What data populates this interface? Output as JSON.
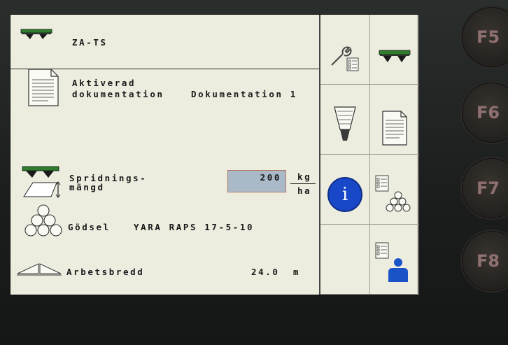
{
  "header": {
    "title": "ZA-TS"
  },
  "documentation": {
    "label_line1": "Aktiverad",
    "label_line2": "dokumentation",
    "value": "Dokumentation 1"
  },
  "application_rate": {
    "label_line1": "Spridnings-",
    "label_line2": "mängd",
    "value": "200",
    "unit_numerator": "kg",
    "unit_denominator": "ha"
  },
  "fertilizer": {
    "label": "Gödsel",
    "value": "YARA RAPS 17-5-10"
  },
  "working_width": {
    "label": "Arbetsbredd",
    "value": "24.0",
    "unit": "m"
  },
  "sidebar": {
    "info_glyph": "i",
    "icons": [
      "wrench-settings-icon",
      "spreader-icon",
      "hopper-icon",
      "document-icon",
      "info-icon",
      "settings-pile-icon",
      "user-settings-icon"
    ]
  },
  "function_keys": [
    "F5",
    "F6",
    "F7",
    "F8"
  ],
  "colors": {
    "screen_bg": "#ececdf",
    "spreader_green": "#2f7d2d",
    "info_blue": "#1848c8",
    "input_bg": "#aab9c8"
  }
}
